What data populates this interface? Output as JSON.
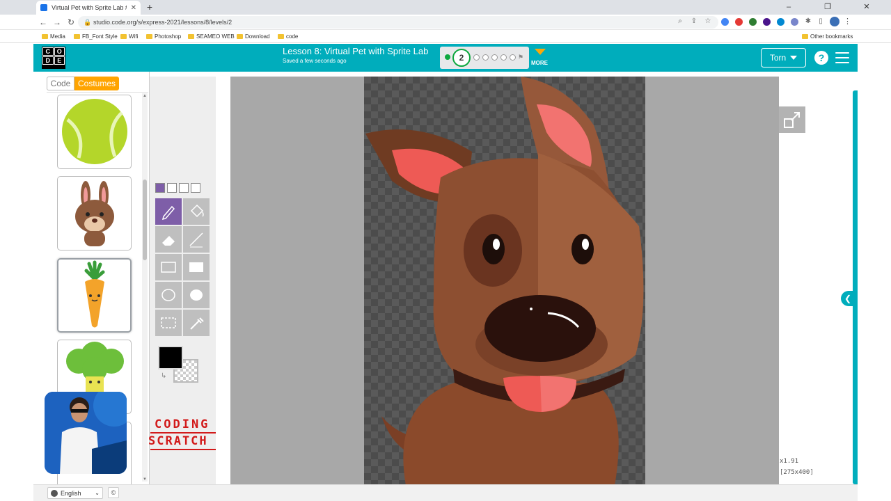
{
  "browser": {
    "tab_title": "Virtual Pet with Sprite Lab #2 | Exp",
    "url": "studio.code.org/s/express-2021/lessons/8/levels/2",
    "bookmarks": [
      "Media",
      "FB_Font Style",
      "Wifi",
      "Photoshop",
      "SEAMEO WEB",
      "Download",
      "code"
    ],
    "other_bookmarks": "Other bookmarks"
  },
  "header": {
    "logo_letters": [
      "C",
      "O",
      "D",
      "E"
    ],
    "lesson_title": "Lesson 8: Virtual Pet with Sprite Lab",
    "saved_status": "Saved a few seconds ago",
    "current_level": "2",
    "more_label": "MORE",
    "user_name": "Torn",
    "help_label": "?"
  },
  "left_panel": {
    "tab_code": "Code",
    "tab_costumes": "Costumes"
  },
  "overlay": {
    "brand_line1": "CODING",
    "brand_line2": "SCRATCH"
  },
  "canvas": {
    "zoom": "x1.91",
    "dimensions": "[275x400]"
  },
  "footer": {
    "language": "English",
    "copyright": "©"
  },
  "colors": {
    "header_teal": "#00adbc",
    "costumes_orange": "#ffa400",
    "active_tool": "#7e5ea8",
    "brand_red": "#d21a1a"
  }
}
